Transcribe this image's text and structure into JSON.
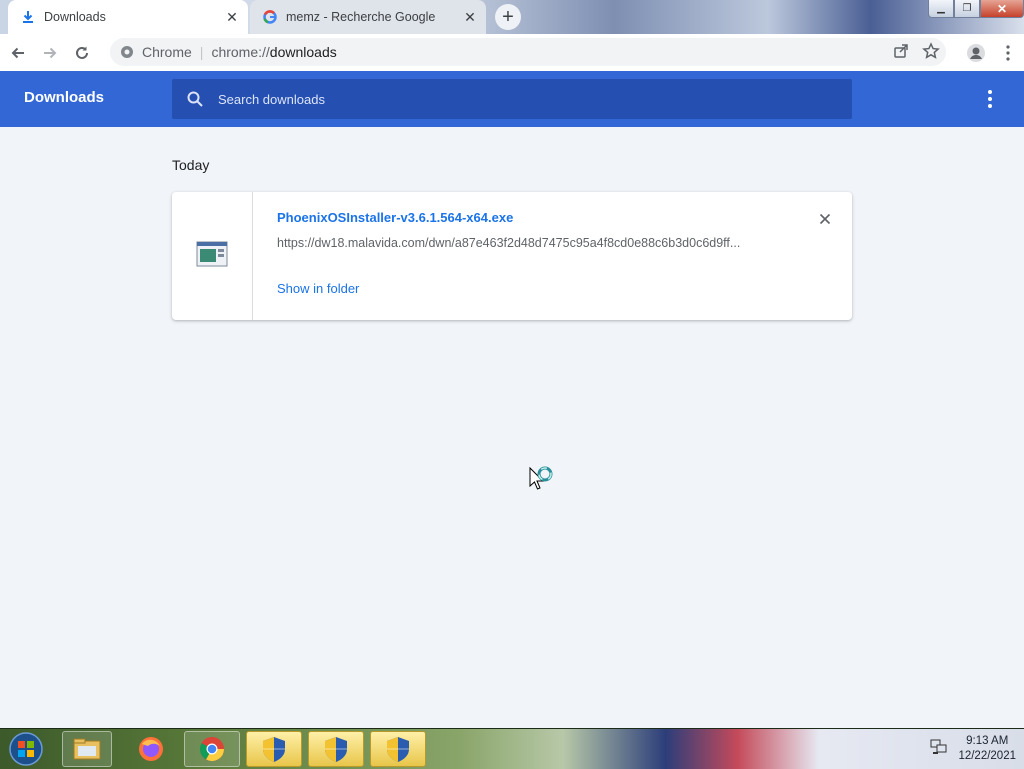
{
  "browser": {
    "tabs": [
      {
        "title": "Downloads",
        "icon": "download-icon",
        "active": true
      },
      {
        "title": "memz - Recherche Google",
        "icon": "google-icon",
        "active": false
      }
    ],
    "omnibox": {
      "site_name": "Chrome",
      "url_scheme": "chrome://",
      "url_path": "downloads"
    }
  },
  "downloads_page": {
    "title": "Downloads",
    "search_placeholder": "Search downloads",
    "date_label": "Today",
    "items": [
      {
        "file_name": "PhoenixOSInstaller-v3.6.1.564-x64.exe",
        "url": "https://dw18.malavida.com/dwn/a87e463f2d48d7475c95a4f8cd0e88c6b3d0c6d9ff...",
        "action_label": "Show in folder",
        "icon": "installer-file-icon"
      }
    ]
  },
  "taskbar": {
    "items": [
      "windows-start-icon",
      "file-explorer-icon",
      "firefox-icon",
      "chrome-icon",
      "uac-shield-icon",
      "uac-shield-icon",
      "uac-shield-icon"
    ],
    "clock": {
      "time": "9:13 AM",
      "date": "12/22/2021"
    }
  },
  "colors": {
    "header_blue": "#3367d6",
    "link_blue": "#1a73e8",
    "page_bg": "#f1f4f8"
  }
}
